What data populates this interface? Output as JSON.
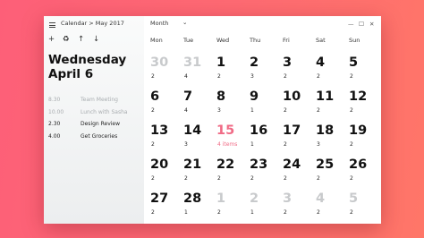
{
  "titlebar": {
    "breadcrumb": "Calendar > May 2017",
    "view_label": "Month",
    "view_chevron": "⌄",
    "minimize_glyph": "—",
    "maximize_glyph": "☐",
    "close_glyph": "✕"
  },
  "toolbar": {
    "add_glyph": "+",
    "sync_glyph": "♻",
    "up_glyph": "↑",
    "down_glyph": "↓"
  },
  "sidebar": {
    "day_name": "Wednesday",
    "date_label": "April 6",
    "events": [
      {
        "time": "8.30",
        "title": "Team Meeting",
        "state": "past"
      },
      {
        "time": "10.00",
        "title": "Lunch with Sasha",
        "state": "past"
      },
      {
        "time": "2.30",
        "title": "Design Review",
        "state": "current"
      },
      {
        "time": "4.00",
        "title": "Get Groceries",
        "state": "current"
      }
    ]
  },
  "calendar": {
    "weekdays": [
      "Mon",
      "Tue",
      "Wed",
      "Thu",
      "Fri",
      "Sat",
      "Sun"
    ],
    "weeks": [
      [
        {
          "day": "30",
          "count": "2",
          "month": "other"
        },
        {
          "day": "31",
          "count": "4",
          "month": "other"
        },
        {
          "day": "1",
          "count": "2"
        },
        {
          "day": "2",
          "count": "3"
        },
        {
          "day": "3",
          "count": "2"
        },
        {
          "day": "4",
          "count": "2"
        },
        {
          "day": "5",
          "count": "2"
        }
      ],
      [
        {
          "day": "6",
          "count": "2"
        },
        {
          "day": "7",
          "count": "4"
        },
        {
          "day": "8",
          "count": "3"
        },
        {
          "day": "9",
          "count": "1"
        },
        {
          "day": "10",
          "count": "2"
        },
        {
          "day": "11",
          "count": "2"
        },
        {
          "day": "12",
          "count": "2"
        }
      ],
      [
        {
          "day": "13",
          "count": "2"
        },
        {
          "day": "14",
          "count": "3"
        },
        {
          "day": "15",
          "count": "4 items",
          "today": true
        },
        {
          "day": "16",
          "count": "1"
        },
        {
          "day": "17",
          "count": "2"
        },
        {
          "day": "18",
          "count": "3"
        },
        {
          "day": "19",
          "count": "2"
        }
      ],
      [
        {
          "day": "20",
          "count": "2"
        },
        {
          "day": "21",
          "count": "2"
        },
        {
          "day": "22",
          "count": "2"
        },
        {
          "day": "23",
          "count": "2"
        },
        {
          "day": "24",
          "count": "2"
        },
        {
          "day": "25",
          "count": "2"
        },
        {
          "day": "26",
          "count": "2"
        }
      ],
      [
        {
          "day": "27",
          "count": "2"
        },
        {
          "day": "28",
          "count": "1"
        },
        {
          "day": "1",
          "count": "2",
          "month": "other"
        },
        {
          "day": "2",
          "count": "1",
          "month": "other"
        },
        {
          "day": "3",
          "count": "2",
          "month": "other"
        },
        {
          "day": "4",
          "count": "2",
          "month": "other"
        },
        {
          "day": "5",
          "count": "2",
          "month": "other"
        }
      ]
    ]
  },
  "colors": {
    "background_start": "#fd5f78",
    "background_end": "#ff7668",
    "today_accent": "#f06b86",
    "other_month": "#c8cacc"
  }
}
